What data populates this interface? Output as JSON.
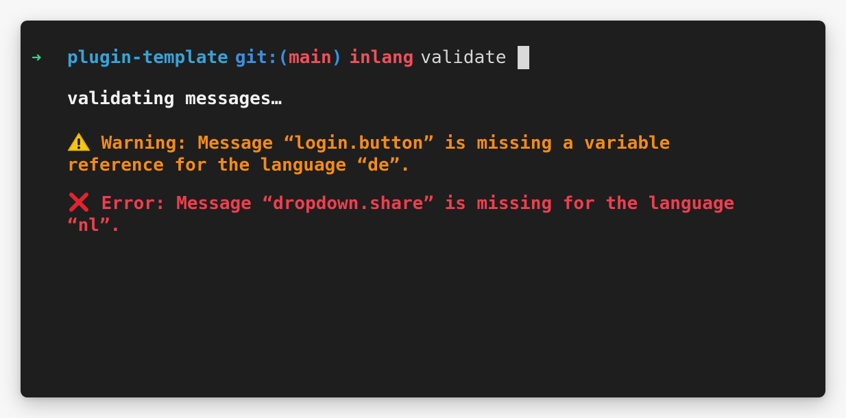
{
  "prompt": {
    "arrow": "➜",
    "directory": "plugin-template",
    "git_prefix": "git:(",
    "branch": "main",
    "git_suffix": ")",
    "command": "inlang",
    "argument": "validate"
  },
  "output": {
    "status": "validating messages…",
    "warning": {
      "icon": "warning-icon",
      "text": "Warning: Message “login.button” is missing a variable reference for the language “de”."
    },
    "error": {
      "icon": "cross-icon",
      "text": "Error: Message “dropdown.share” is missing for the language “nl”."
    }
  },
  "colors": {
    "background": "#1e1e1e",
    "arrow": "#3ecf8e",
    "directory": "#36a3d9",
    "git": "#3a8fe0",
    "branch": "#ef4f5a",
    "warning": "#f28b1a",
    "error": "#ee3f4e"
  }
}
